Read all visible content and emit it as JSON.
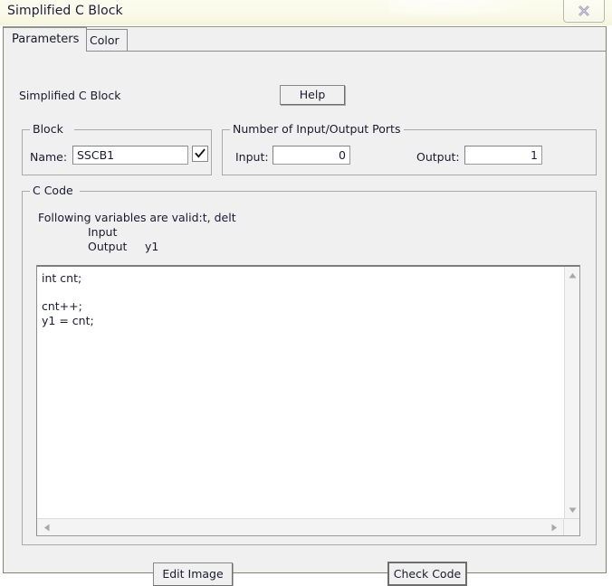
{
  "window": {
    "title": "Simplified C Block",
    "close_icon": "close-x-icon"
  },
  "tabs": [
    {
      "label": "Parameters",
      "active": true
    },
    {
      "label": "Color",
      "active": false
    }
  ],
  "header": {
    "caption": "Simplified C Block",
    "help_label": "Help"
  },
  "block_group": {
    "title": "Block",
    "name_label": "Name:",
    "name_value": "SSCB1",
    "name_placeholder": "",
    "checkbox_checked": true,
    "check_icon": "checkmark-icon"
  },
  "ports_group": {
    "title": "Number of Input/Output Ports",
    "input_label": "Input:",
    "input_value": "0",
    "output_label": "Output:",
    "output_value": "1"
  },
  "ccode_group": {
    "title": "C Code",
    "hint_line1": "Following variables are valid:t, delt",
    "hint_line2": "Input",
    "hint_line3": "Output",
    "hint_line3_value": "y1",
    "code_value": "int cnt;\n\ncnt++;\ny1 = cnt;",
    "code_placeholder": "",
    "scroll_up_icon": "triangle-up-icon",
    "scroll_down_icon": "triangle-down-icon",
    "scroll_left_icon": "triangle-left-icon",
    "scroll_right_icon": "triangle-right-icon"
  },
  "footer": {
    "edit_image_label": "Edit Image",
    "check_code_label": "Check Code"
  },
  "colors": {
    "dialog_face": "#f0f0f0",
    "titlebar": "#fbfbee",
    "field_bg": "#ffffff",
    "border": "#a9a9a9",
    "text": "#1a1a2e"
  }
}
